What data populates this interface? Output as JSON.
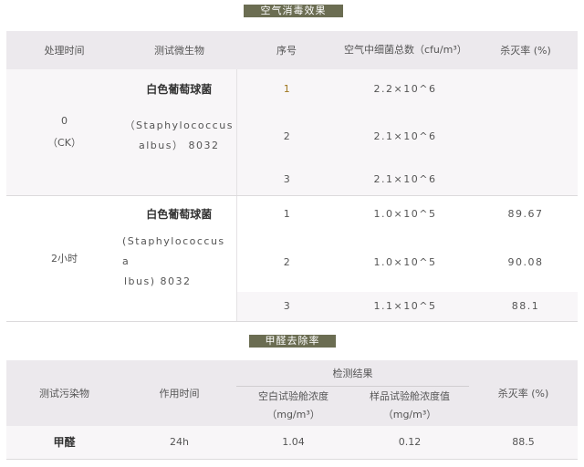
{
  "table1": {
    "title": "空气消毒效果",
    "headers": [
      "处理时间",
      "测试微生物",
      "序号",
      "空气中细菌总数（cfu/m³）",
      "杀灭率 (%)"
    ],
    "groups": [
      {
        "time_line1": "0",
        "time_line2": "（CK）",
        "microbe_cn": "白色葡萄球菌",
        "microbe_latin_1": "（Staphylococcus",
        "microbe_latin_2": "albus） 8032",
        "rows": [
          {
            "no": "1",
            "count": "2.2×10^6",
            "rate": ""
          },
          {
            "no": "2",
            "count": "2.1×10^6",
            "rate": ""
          },
          {
            "no": "3",
            "count": "2.1×10^6",
            "rate": ""
          }
        ]
      },
      {
        "time_line1": "2小时",
        "microbe_cn": "白色葡萄球菌",
        "microbe_latin_1": "(Staphylococcus a",
        "microbe_latin_2": "lbus) 8032",
        "rows": [
          {
            "no": "1",
            "count": "1.0×10^5",
            "rate": "89.67"
          },
          {
            "no": "2",
            "count": "1.0×10^5",
            "rate": "90.08"
          },
          {
            "no": "3",
            "count": "1.1×10^5",
            "rate": "88.1"
          }
        ]
      }
    ]
  },
  "table2": {
    "title": "甲醛去除率",
    "headers": {
      "pollutant": "测试污染物",
      "time": "作用时间",
      "result": "检测结果",
      "blank": "空白试验舱浓度（mg/m³）",
      "sample": "样品试验舱浓度值（mg/m³）",
      "rate": "杀灭率 (%)"
    },
    "rows": [
      {
        "pollutant": "甲醛",
        "time": "24h",
        "blank": "1.04",
        "sample": "0.12",
        "rate": "88.5"
      }
    ]
  }
}
